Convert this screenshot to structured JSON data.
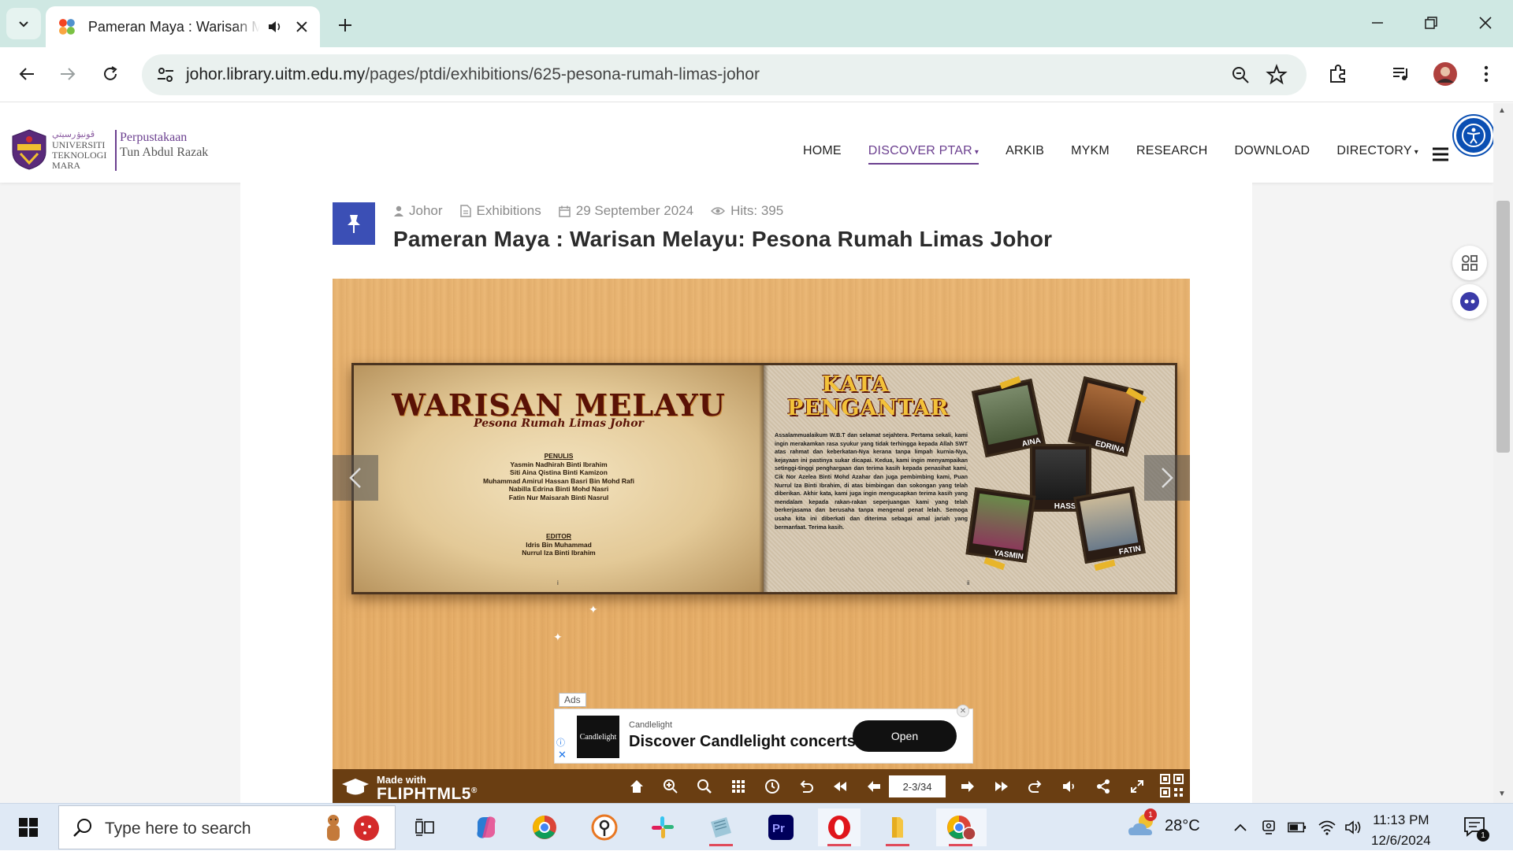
{
  "browser": {
    "tab_title": "Pameran Maya : Warisan Melayu: Pesona Rumah Limas Johor",
    "url_host": "johor.library.uitm.edu.my",
    "url_path": "/pages/ptdi/exhibitions/625-pesona-rumah-limas-johor"
  },
  "site": {
    "logo": {
      "uni_line1": "UNIVERSITI",
      "uni_line2": "TEKNOLOGI",
      "uni_line3": "MARA",
      "lib_line1": "Perpustakaan",
      "lib_line2": "Tun Abdul Razak"
    },
    "nav": [
      {
        "label": "HOME"
      },
      {
        "label": "DISCOVER PTAR",
        "dropdown": true,
        "active": true
      },
      {
        "label": "ARKIB"
      },
      {
        "label": "MYKM"
      },
      {
        "label": "RESEARCH"
      },
      {
        "label": "DOWNLOAD"
      },
      {
        "label": "DIRECTORY",
        "dropdown": true
      }
    ]
  },
  "article": {
    "meta": {
      "author": "Johor",
      "category": "Exhibitions",
      "date": "29 September 2024",
      "hits": "Hits: 395"
    },
    "title": "Pameran Maya : Warisan Melayu: Pesona Rumah Limas Johor"
  },
  "flipbook": {
    "left_page": {
      "title": "WARISAN MELAYU",
      "subtitle": "Pesona Rumah Limas Johor",
      "writers_heading": "PENULIS",
      "writers": [
        "Yasmin Nadhirah Binti Ibrahim",
        "Siti Aina Qistina Binti Kamizon",
        "Muhammad Amirul Hassan Basri Bin Mohd Rafi",
        "Nabilla Edrina Binti Mohd Nasri",
        "Fatin Nur Maisarah Binti Nasrul"
      ],
      "editor_heading": "EDITOR",
      "editors": [
        "Idris Bin Muhammad",
        "Nurrul Iza Binti Ibrahim"
      ],
      "page_number": "i"
    },
    "right_page": {
      "title_line1": "KATA",
      "title_line2": "PENGANTAR",
      "body": "Assalammualaikum W.B.T dan selamat sejahtera. Pertama sekali, kami ingin merakamkan rasa syukur yang tidak terhingga kepada Allah SWT atas rahmat dan keberkatan-Nya kerana tanpa limpah kurnia-Nya, kejayaan ini pastinya sukar dicapai. Kedua, kami ingin menyampaikan setinggi-tinggi penghargaan dan terima kasih kepada penasihat kami, Cik Nor Azelea Binti Mohd Azahar dan juga pembimbing kami, Puan Nurrul Iza Binti Ibrahim, di atas bimbingan dan sokongan yang telah diberikan. Akhir kata, kami juga ingin mengucapkan terima kasih yang mendalam kepada rakan-rakan seperjuangan kami yang telah berkerjasama dan berusaha tanpa mengenal penat lelah. Semoga usaha kita ini diberkati dan diterima sebagai amal jariah yang bermanfaat. Terima kasih.",
      "photos": [
        "AINA",
        "EDRINA",
        "HASSAN",
        "YASMIN",
        "FATIN"
      ],
      "page_number": "ii"
    },
    "ad": {
      "label": "Ads",
      "logo_text": "Candlelight",
      "brand": "Candlelight",
      "headline": "Discover Candlelight concerts",
      "cta": "Open"
    },
    "bar": {
      "made_with": "Made with",
      "brand": "FLIPHTML5",
      "page_indicator": "2-3/34"
    }
  },
  "taskbar": {
    "search_placeholder": "Type here to search",
    "temperature": "28°C",
    "time": "11:13 PM",
    "date": "12/6/2024",
    "notification_count": "1",
    "weather_badge": "1"
  }
}
